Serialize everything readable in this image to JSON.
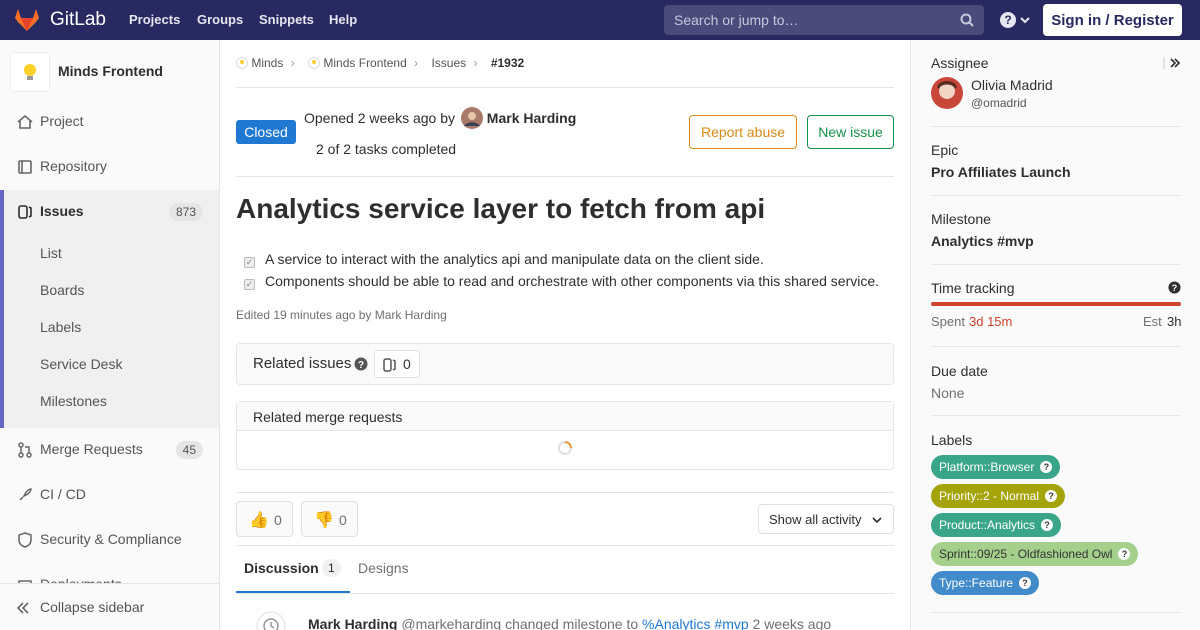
{
  "nav": {
    "brand": "GitLab",
    "links": [
      "Projects",
      "Groups",
      "Snippets",
      "Help"
    ],
    "search_placeholder": "Search or jump to…",
    "signin": "Sign in / Register"
  },
  "sidebar": {
    "project_name": "Minds Frontend",
    "items": [
      {
        "label": "Project"
      },
      {
        "label": "Repository"
      },
      {
        "label": "Issues",
        "count": "873"
      },
      {
        "label": "Merge Requests",
        "count": "45"
      },
      {
        "label": "CI / CD"
      },
      {
        "label": "Security & Compliance"
      },
      {
        "label": "Deployments"
      }
    ],
    "issues_sub": [
      "List",
      "Boards",
      "Labels",
      "Service Desk",
      "Milestones"
    ],
    "collapse": "Collapse sidebar"
  },
  "breadcrumb": [
    "Minds",
    "Minds Frontend",
    "Issues",
    "#1932"
  ],
  "issue": {
    "status": "Closed",
    "opened_prefix": "Opened",
    "opened_time": "2 weeks ago",
    "opened_by": "by",
    "author": "Mark Harding",
    "tasks": "2 of 2 tasks completed",
    "report_abuse": "Report abuse",
    "new_issue": "New issue",
    "title": "Analytics service layer to fetch from api",
    "task_items": [
      "A service to interact with the analytics api and manipulate data on the client side.",
      "Components should be able to read and orchestrate with other components via this shared service."
    ],
    "edited": "Edited 19 minutes ago by Mark Harding",
    "related_issues": "Related issues",
    "related_issues_count": "0",
    "related_mrs": "Related merge requests",
    "thumbs_up": "0",
    "thumbs_down": "0",
    "show_activity": "Show all activity",
    "tab_discussion": "Discussion",
    "tab_discussion_count": "1",
    "tab_designs": "Designs",
    "activity": {
      "author": "Mark Harding",
      "handle": "@markeharding",
      "action": "changed milestone to",
      "milestone": "%Analytics #mvp",
      "time": "2 weeks ago"
    }
  },
  "right": {
    "assignee_title": "Assignee",
    "assignee_name": "Olivia Madrid",
    "assignee_handle": "@omadrid",
    "epic_title": "Epic",
    "epic": "Pro Affiliates Launch",
    "milestone_title": "Milestone",
    "milestone": "Analytics #mvp",
    "time_title": "Time tracking",
    "spent_label": "Spent",
    "spent": "3d 15m",
    "est_label": "Est",
    "est": "3h",
    "due_title": "Due date",
    "due": "None",
    "labels_title": "Labels",
    "labels": [
      {
        "text": "Platform::Browser",
        "bg": "#3aa689",
        "fg": "#ffffff"
      },
      {
        "text": "Priority::2 - Normal",
        "bg": "#a5a30a",
        "fg": "#ffffff"
      },
      {
        "text": "Product::Analytics",
        "bg": "#3aa689",
        "fg": "#ffffff"
      },
      {
        "text": "Sprint::09/25 - Oldfashioned Owl",
        "bg": "#a4d08c",
        "fg": "#333333"
      },
      {
        "text": "Type::Feature",
        "bg": "#428bca",
        "fg": "#ffffff"
      }
    ]
  },
  "colors": {
    "nav_bg": "#292961",
    "closed": "#1f78d1",
    "report_abuse": "#d98a17",
    "new_issue": "#168f48",
    "time_bar": "#d2412f",
    "spent": "#d2412f",
    "link": "#1f78d1"
  }
}
